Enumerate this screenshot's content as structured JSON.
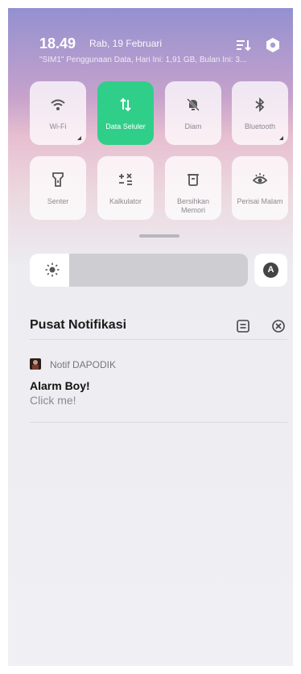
{
  "status": {
    "time": "18.49",
    "date": "Rab, 19 Februari",
    "data_usage": "\"SIM1\" Penggunaan Data, Hari Ini: 1,91 GB, Bulan Ini: 3..."
  },
  "toggles": [
    {
      "label": "Wi-Fi",
      "icon": "wifi-icon",
      "active": false
    },
    {
      "label": "Data Seluler",
      "icon": "mobile-data-icon",
      "active": true
    },
    {
      "label": "Diam",
      "icon": "silent-bell-icon",
      "active": false
    },
    {
      "label": "Bluetooth",
      "icon": "bluetooth-icon",
      "active": false
    },
    {
      "label": "Senter",
      "icon": "flashlight-icon",
      "active": false
    },
    {
      "label": "Kalkulator",
      "icon": "calculator-icon",
      "active": false
    },
    {
      "label": "Bersihkan Memori",
      "icon": "trash-icon",
      "active": false
    },
    {
      "label": "Perisai Malam",
      "icon": "eye-shield-icon",
      "active": false
    }
  ],
  "brightness": {
    "level": 0.18,
    "auto_label": "A"
  },
  "notification_center": {
    "title": "Pusat Notifikasi"
  },
  "notifications": [
    {
      "app": "Notif DAPODIK",
      "title": "Alarm Boy!",
      "body": "Click me!"
    }
  ],
  "colors": {
    "accent": "#2fcf89"
  }
}
